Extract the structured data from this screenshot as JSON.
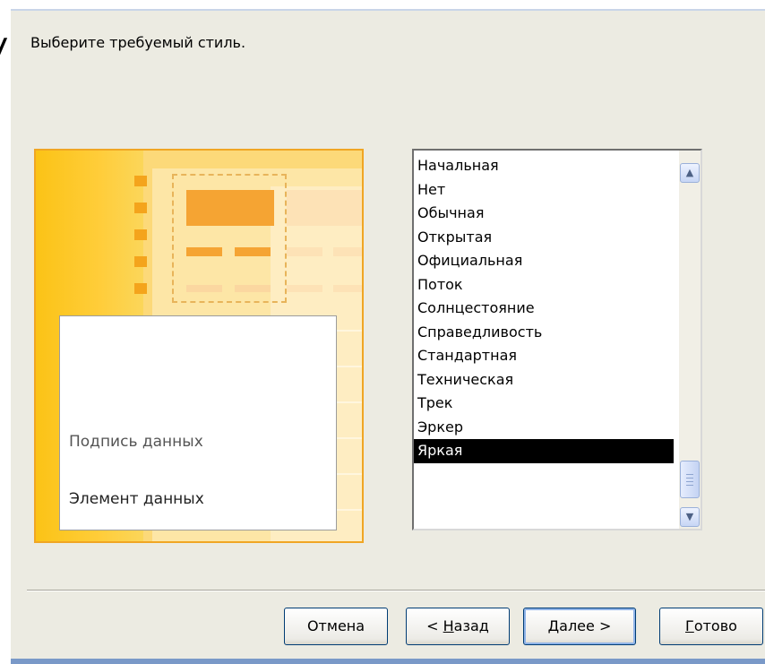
{
  "prompt": "Выберите требуемый стиль.",
  "edge_fragment": "УІ",
  "preview": {
    "sample_caption": "Подпись данных",
    "sample_item": "Элемент данных"
  },
  "style_list": {
    "items": [
      "Начальная",
      "Нет",
      "Обычная",
      "Открытая",
      "Официальная",
      "Поток",
      "Солнцестояние",
      "Справедливость",
      "Стандартная",
      "Техническая",
      "Трек",
      "Эркер",
      "Яркая"
    ],
    "selected": "Яркая"
  },
  "buttons": {
    "cancel": "Отмена",
    "back_prefix": "< ",
    "back_hotkey": "Н",
    "back_rest": "азад",
    "next_hotkey": "Д",
    "next_rest": "алее >",
    "finish_hotkey": "Г",
    "finish_rest": "отово"
  },
  "colors": {
    "dialog_bg": "#ecebe2",
    "preview_accent": "#f4a41c",
    "selection": "#000000"
  }
}
